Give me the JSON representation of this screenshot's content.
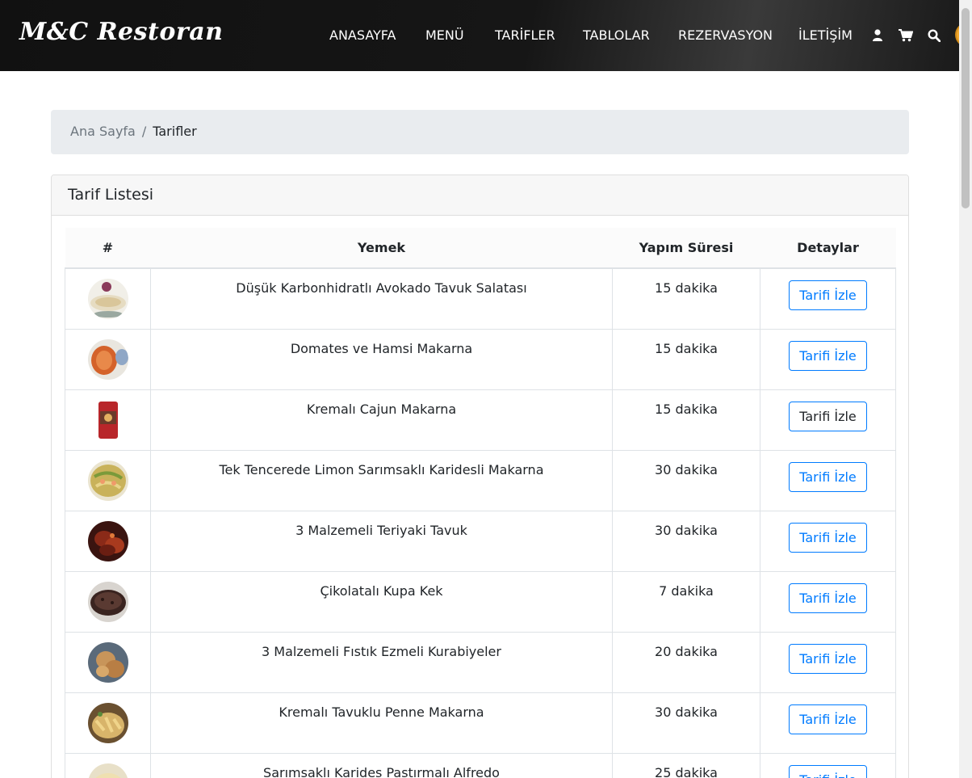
{
  "brand": "M&C Restoran",
  "nav": {
    "links": [
      "ANASAYFA",
      "MENÜ",
      "TARİFLER",
      "TABLOLAR",
      "REZERVASYON",
      "İLETİŞİM"
    ],
    "icons": [
      "user-icon",
      "cart-icon",
      "search-icon"
    ]
  },
  "breadcrumb": {
    "home": "Ana Sayfa",
    "separator": "/",
    "current": "Tarifler"
  },
  "card": {
    "title": "Tarif Listesi"
  },
  "table": {
    "headers": [
      "#",
      "Yemek",
      "Yapım Süresi",
      "Detaylar"
    ],
    "rows": [
      {
        "name": "Düşük Karbonhidratlı Avokado Tavuk Salatası",
        "time": "15 dakika",
        "button": "Tarifi İzle"
      },
      {
        "name": "Domates ve Hamsi Makarna",
        "time": "15 dakika",
        "button": "Tarifi İzle"
      },
      {
        "name": "Kremalı Cajun Makarna",
        "time": "15 dakika",
        "button": "Tarifi İzle"
      },
      {
        "name": "Tek Tencerede Limon Sarımsaklı Karidesli Makarna",
        "time": "30 dakika",
        "button": "Tarifi İzle"
      },
      {
        "name": "3 Malzemeli Teriyaki Tavuk",
        "time": "30 dakika",
        "button": "Tarifi İzle"
      },
      {
        "name": "Çikolatalı Kupa Kek",
        "time": "7 dakika",
        "button": "Tarifi İzle"
      },
      {
        "name": "3 Malzemeli Fıstık Ezmeli Kurabiyeler",
        "time": "20 dakika",
        "button": "Tarifi İzle"
      },
      {
        "name": "Kremalı Tavuklu Penne Makarna",
        "time": "30 dakika",
        "button": "Tarifi İzle"
      },
      {
        "name": "Sarımsaklı Karides Pastırmalı Alfredo",
        "time": "25 dakika",
        "button": "Tarifi İzle"
      }
    ]
  },
  "colors": {
    "accent": "#007bff",
    "navbar": "#111111",
    "breadcrumb_bg": "#e9ecef"
  }
}
